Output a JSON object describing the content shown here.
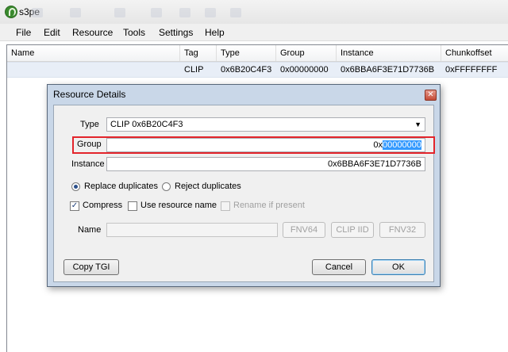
{
  "window": {
    "title": "s3pe",
    "icon": "app-icon"
  },
  "menu": [
    "File",
    "Edit",
    "Resource",
    "Tools",
    "Settings",
    "Help"
  ],
  "list": {
    "columns": [
      "Name",
      "Tag",
      "Type",
      "Group",
      "Instance",
      "Chunkoffset"
    ],
    "rows": [
      {
        "name": "",
        "tag": "CLIP",
        "type": "0x6B20C4F3",
        "group": "0x00000000",
        "instance": "0x6BBA6F3E71D7736B",
        "chunkoffset": "0xFFFFFFFF"
      }
    ]
  },
  "dialog": {
    "title": "Resource Details",
    "close_icon": "close-icon",
    "type_label": "Type",
    "type_value": "CLIP 0x6B20C4F3",
    "group_label": "Group",
    "group_prefix": "0x",
    "group_selected": "00000000",
    "instance_label": "Instance",
    "instance_value": "0x6BBA6F3E71D7736B",
    "replace_duplicates": "Replace duplicates",
    "reject_duplicates": "Reject duplicates",
    "compress": "Compress",
    "use_resource_name": "Use resource name",
    "rename_if_present": "Rename if present",
    "name_label": "Name",
    "name_value": "",
    "fnv64": "FNV64",
    "clip_iid": "CLIP IID",
    "fnv32": "FNV32",
    "copy_tgi": "Copy TGI",
    "cancel": "Cancel",
    "ok": "OK",
    "state": {
      "replace_selected": true,
      "compress_checked": true,
      "use_resource_name_checked": false,
      "rename_if_present_checked": false
    }
  },
  "colors": {
    "highlight": "#e3242b",
    "selection": "#3399ff",
    "dialog_frame": "#c9d7e8"
  }
}
